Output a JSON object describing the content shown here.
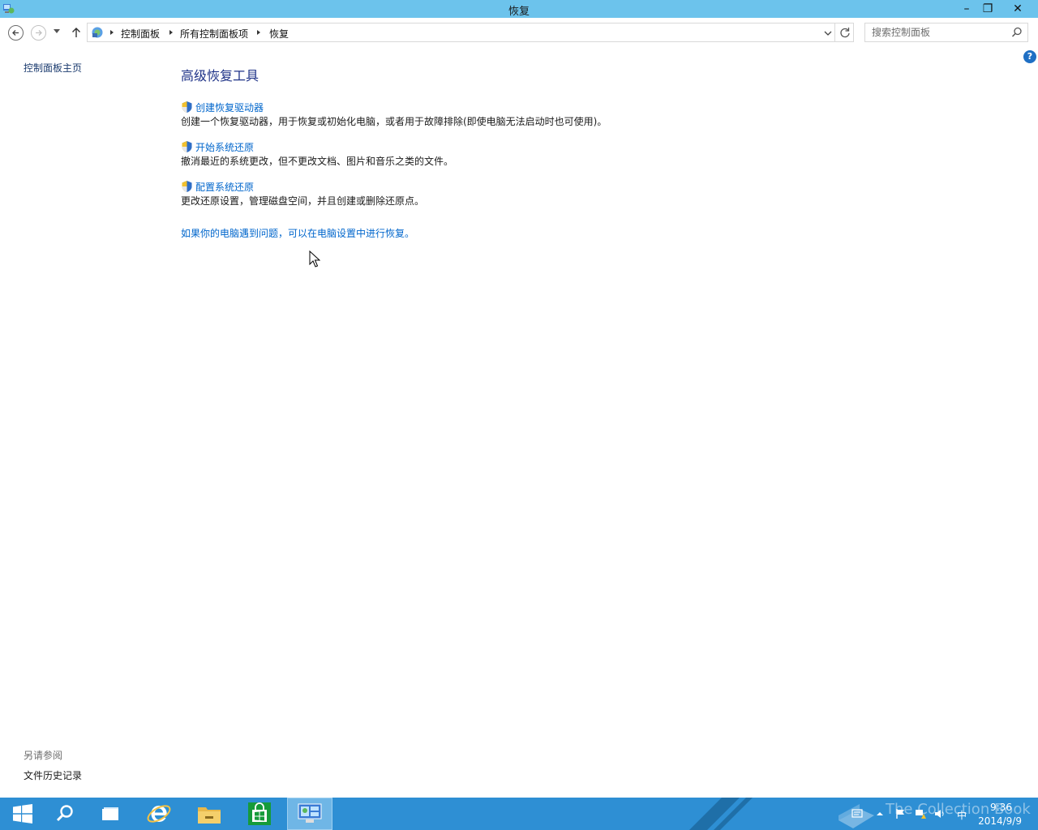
{
  "window": {
    "title": "恢复"
  },
  "titlebar_buttons": {
    "minimize": "–",
    "maximize": "❐",
    "close": "✕"
  },
  "address": {
    "crumbs": [
      "控制面板",
      "所有控制面板项",
      "恢复"
    ]
  },
  "search": {
    "placeholder": "搜索控制面板"
  },
  "left_pane": {
    "home_link": "控制面板主页",
    "see_also_heading": "另请参阅",
    "see_also_items": [
      "文件历史记录"
    ]
  },
  "main": {
    "heading": "高级恢复工具",
    "tasks": [
      {
        "label": "创建恢复驱动器",
        "description": "创建一个恢复驱动器，用于恢复或初始化电脑，或者用于故障排除(即使电脑无法启动时也可使用)。"
      },
      {
        "label": "开始系统还原",
        "description": "撤消最近的系统更改，但不更改文档、图片和音乐之类的文件。"
      },
      {
        "label": "配置系统还原",
        "description": "更改还原设置，管理磁盘空间，并且创建或删除还原点。"
      }
    ],
    "pc_settings_link": "如果你的电脑遇到问题，可以在电脑设置中进行恢复。"
  },
  "help_icon_label": "?",
  "taskbar": {
    "items": [
      "start-icon",
      "search-icon",
      "task-view-icon",
      "internet-explorer-icon",
      "file-explorer-icon",
      "store-icon",
      "control-panel-icon"
    ],
    "active_item": "control-panel-icon",
    "watermark": "The Collection Book",
    "ime": "中",
    "clock_time": "9:36",
    "clock_date": "2014/9/9"
  },
  "colors": {
    "titlebar": "#6cc3ec",
    "taskbar": "#2e8fd4",
    "link": "#0066cc",
    "heading": "#1e3287"
  }
}
